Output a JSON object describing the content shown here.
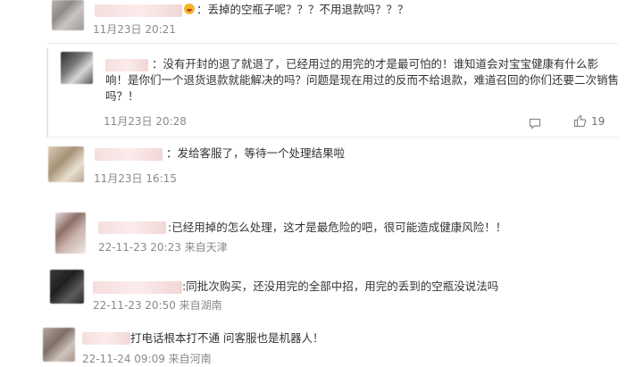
{
  "comments": [
    {
      "text": "：丢掉的空瓶子呢？？？不用退款吗？？？",
      "time": "11月23日 20:21"
    },
    {
      "text": "：没有开封的退了就退了，已经用过的用完的才是最可怕的！谁知道会对宝宝健康有什么影响！是你们一个退货退款就能解决的吗？问题是现在用过的反而不给退款，难道召回的你们还要二次销售吗？！",
      "time": "11月23日 20:28",
      "like_count": "19"
    },
    {
      "text": "：发给客服了，等待一个处理结果啦",
      "time": "11月23日 16:15"
    },
    {
      "text": ":已经用掉的怎么处理，这才是最危险的吧，很可能造成健康风险！！",
      "time": "22-11-23 20:23 来自天津"
    },
    {
      "text": ":同批次购买，还没用完的全部中招，用完的丢到的空瓶没说法吗",
      "time": "22-11-23 20:50 来自湖南"
    },
    {
      "text": "打电话根本打不通 问客服也是机器人！",
      "time": "22-11-24 09:09 来自河南"
    }
  ],
  "icons": {
    "comment": "comment-icon",
    "like": "thumbs-up-icon"
  }
}
